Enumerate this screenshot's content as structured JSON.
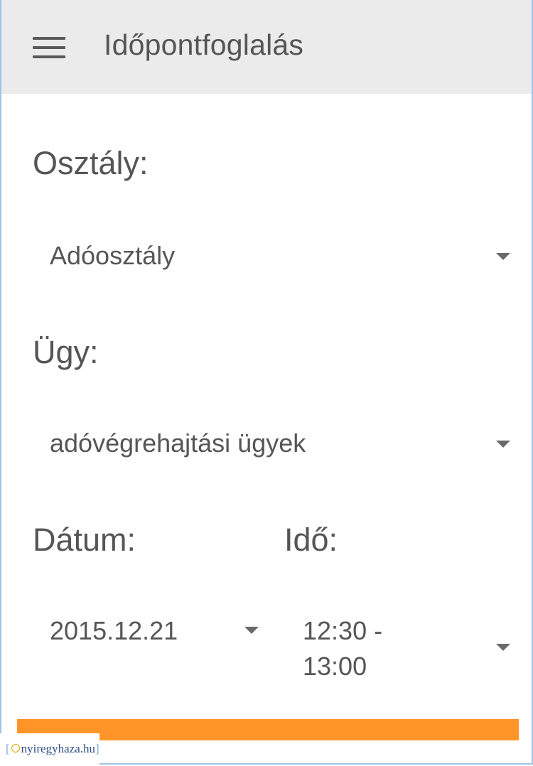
{
  "appbar": {
    "title": "Időpontfoglalás",
    "menu_icon": "hamburger-menu-icon"
  },
  "form": {
    "department_label": "Osztály:",
    "department_value": "Adóosztály",
    "case_label": "Ügy:",
    "case_value": "adóvégrehajtási ügyek",
    "date_label": "Dátum:",
    "date_value": "2015.12.21",
    "time_label": "Idő:",
    "time_value_line1": "12:30 -",
    "time_value_line2": "13:00"
  },
  "colors": {
    "appbar_bg": "#ebebeb",
    "submit_bar": "#ff9528",
    "text": "#555555",
    "frame_border": "#9ec3e6"
  },
  "watermark": {
    "text": "nyiregyhaza.hu",
    "left_bracket": "[",
    "right_bracket": "]"
  }
}
